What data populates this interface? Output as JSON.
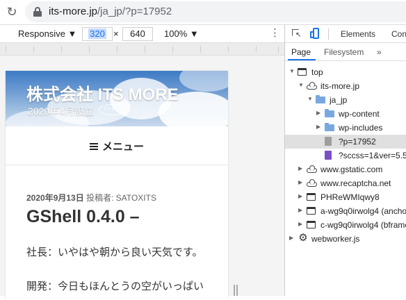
{
  "browser": {
    "url_host": "its-more.jp",
    "url_path": "/ja_jp/?p=17952"
  },
  "device_toolbar": {
    "mode": "Responsive ▼",
    "width": "320",
    "times": "×",
    "height": "640",
    "zoom": "100% ▼",
    "more": "⋮"
  },
  "site": {
    "title": "株式会社 ITS MORE",
    "description": "2020年4月設立",
    "badge": "ITS more",
    "menu_label": "メニュー",
    "post_meta_date": "2020年9月13日",
    "post_meta_author": "投稿者: SATOXITS",
    "post_title": "GShell 0.4.0 –",
    "paragraphs": [
      "社長：いやはや朝から良い天気です。",
      "開発：今日もほんとうの空がいっぱい"
    ]
  },
  "devtools": {
    "tabs": [
      "Elements",
      "Con"
    ],
    "subtabs": [
      "Page",
      "Filesystem",
      "»"
    ],
    "tree": [
      {
        "label": "top",
        "icon": "frame-icon",
        "arrow": "▼",
        "depth": 0
      },
      {
        "label": "its-more.jp",
        "icon": "cloud-icon",
        "arrow": "▼",
        "depth": 1
      },
      {
        "label": "ja_jp",
        "icon": "folder-icon",
        "arrow": "▼",
        "depth": 2
      },
      {
        "label": "wp-content",
        "icon": "folder-icon",
        "arrow": "▶",
        "depth": 3
      },
      {
        "label": "wp-includes",
        "icon": "folder-icon",
        "arrow": "▶",
        "depth": 3
      },
      {
        "label": "?p=17952",
        "icon": "document-icon",
        "arrow": "",
        "depth": 3,
        "selected": true
      },
      {
        "label": "?sccss=1&ver=5.5.",
        "icon": "script-icon",
        "arrow": "",
        "depth": 3
      },
      {
        "label": "www.gstatic.com",
        "icon": "cloud-icon",
        "arrow": "▶",
        "depth": 1
      },
      {
        "label": "www.recaptcha.net",
        "icon": "cloud-icon",
        "arrow": "▶",
        "depth": 1
      },
      {
        "label": "PHReWMIqwy8",
        "icon": "frame-icon",
        "arrow": "▶",
        "depth": 1
      },
      {
        "label": "a-wg9q0irwolg4 (ancho",
        "icon": "frame-icon",
        "arrow": "▶",
        "depth": 1
      },
      {
        "label": "c-wg9q0irwolg4 (bframe",
        "icon": "frame-icon",
        "arrow": "▶",
        "depth": 1
      },
      {
        "label": "webworker.js",
        "icon": "gear-icon",
        "arrow": "▶",
        "depth": 0
      }
    ]
  }
}
